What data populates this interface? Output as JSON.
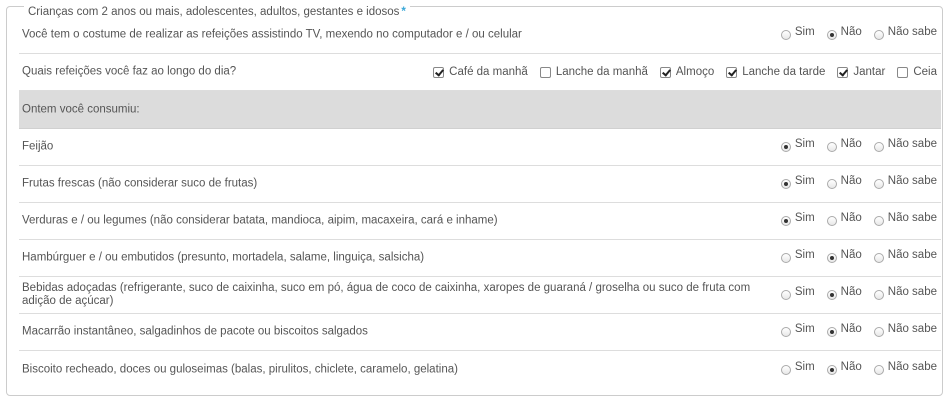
{
  "section": {
    "title": "Crianças com 2 anos ou mais, adolescentes, adultos, gestantes e idosos",
    "required_mark": "*"
  },
  "options": {
    "sim": "Sim",
    "nao": "Não",
    "nao_sabe": "Não sabe"
  },
  "q_tv": {
    "label": "Você tem o costume de realizar as refeições assistindo TV, mexendo no computador e / ou celular",
    "selected": "nao"
  },
  "q_meals": {
    "label": "Quais refeições você faz ao longo do dia?",
    "items": [
      {
        "label": "Café da manhã",
        "checked": true
      },
      {
        "label": "Lanche da manhã",
        "checked": false
      },
      {
        "label": "Almoço",
        "checked": true
      },
      {
        "label": "Lanche da tarde",
        "checked": true
      },
      {
        "label": "Jantar",
        "checked": true
      },
      {
        "label": "Ceia",
        "checked": false
      }
    ]
  },
  "yesterday_header": "Ontem você consumiu:",
  "foods": [
    {
      "label": "Feijão",
      "selected": "sim"
    },
    {
      "label": "Frutas frescas (não considerar suco de frutas)",
      "selected": "sim"
    },
    {
      "label": "Verduras e / ou legumes (não considerar batata, mandioca, aipim, macaxeira, cará e inhame)",
      "selected": "sim"
    },
    {
      "label": "Hambúrguer e / ou embutidos (presunto, mortadela, salame, linguiça, salsicha)",
      "selected": "nao"
    },
    {
      "label": "Bebidas adoçadas (refrigerante, suco de caixinha, suco em pó, água de coco de caixinha, xaropes de guaraná / groselha ou suco de fruta com adição de açúcar)",
      "selected": "nao"
    },
    {
      "label": "Macarrão instantâneo, salgadinhos de pacote ou biscoitos salgados",
      "selected": "nao"
    },
    {
      "label": "Biscoito recheado, doces ou guloseimas (balas, pirulitos, chiclete, caramelo, gelatina)",
      "selected": "nao"
    }
  ]
}
